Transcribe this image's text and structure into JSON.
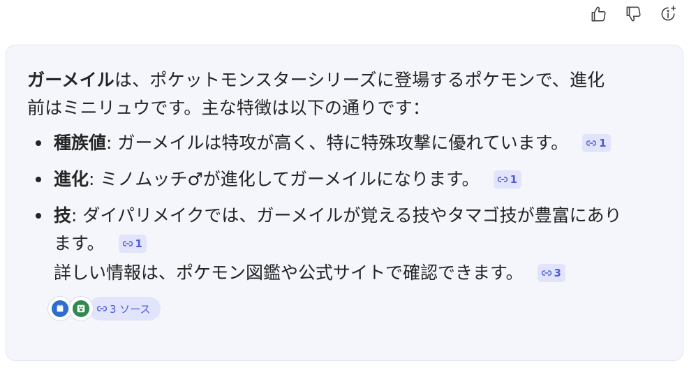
{
  "feedback": {
    "thumbs_up": "thumbs-up-icon",
    "thumbs_down": "thumbs-down-icon",
    "info": "sparkle-info-icon"
  },
  "answer": {
    "intro_bold": "ガーメイル",
    "intro_rest_line1": "は、ポケットモンスターシリーズに登場するポケモンで、進化",
    "intro_line2": "前はミニリュウです。主な特徴は以下の通りです：",
    "bullets": [
      {
        "term": "種族値",
        "text": ": ガーメイルは特攻が高く、特に特殊攻撃に優れています。",
        "cite": "1"
      },
      {
        "term": "進化",
        "text": ": ミノムッチ♂が進化してガーメイルになります。",
        "cite": "1"
      },
      {
        "term": "技",
        "text_line1": ": ダイパリメイクでは、ガーメイルが覚える技やタマゴ技が豊富にあり",
        "text_line2": "ます。",
        "cite": "1"
      }
    ],
    "followup": "詳しい情報は、ポケモン図鑑や公式サイトで確認できます。",
    "followup_cite": "3",
    "sources_label": "3 ソース"
  },
  "colors": {
    "card_bg": "#f5f6fc",
    "accent": "#4f5bd5",
    "chip_bg": "#e1e4fb"
  }
}
